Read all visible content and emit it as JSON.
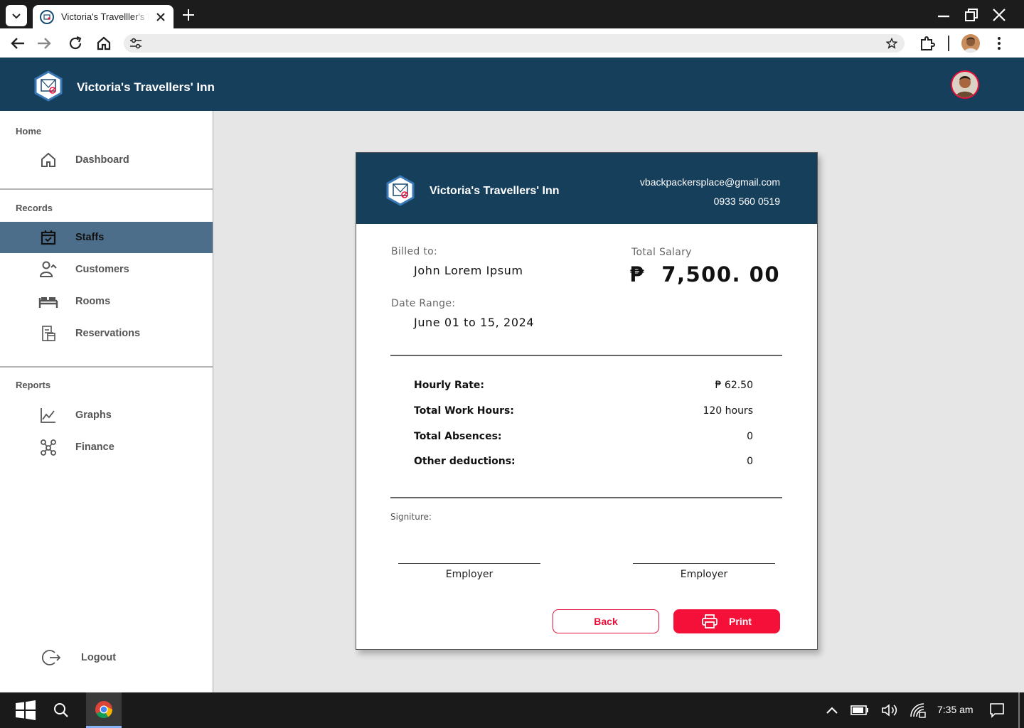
{
  "browser": {
    "tab_title": "Victoria's Travelller's Inn",
    "address": ""
  },
  "app": {
    "name": "Victoria's Travellers' Inn"
  },
  "sidebar": {
    "sections": [
      {
        "heading": "Home",
        "items": [
          {
            "label": "Dashboard",
            "icon": "home-icon"
          }
        ]
      },
      {
        "heading": "Records",
        "items": [
          {
            "label": "Staffs",
            "icon": "calendar-check-icon",
            "active": true
          },
          {
            "label": "Customers",
            "icon": "customers-icon"
          },
          {
            "label": "Rooms",
            "icon": "bed-icon"
          },
          {
            "label": "Reservations",
            "icon": "reservations-icon"
          }
        ]
      },
      {
        "heading": "Reports",
        "items": [
          {
            "label": "Graphs",
            "icon": "line-chart-icon"
          },
          {
            "label": "Finance",
            "icon": "finance-icon"
          }
        ]
      }
    ],
    "logout_label": "Logout"
  },
  "receipt": {
    "business_name": "Victoria's Travellers' Inn",
    "email": "vbackpackersplace@gmail.com",
    "phone": "0933 560 0519",
    "billed_to_label": "Billed to:",
    "billed_to": "John Lorem Ipsum",
    "date_range_label": "Date Range:",
    "date_range": "June 01 to 15, 2024",
    "total_label": "Total Salary",
    "total_amount": "₱  7,500. 00",
    "rows": [
      {
        "label": "Hourly Rate:",
        "value": "₱ 62.50"
      },
      {
        "label": "Total Work Hours:",
        "value": "120 hours"
      },
      {
        "label": "Total Absences:",
        "value": "0"
      },
      {
        "label": "Other deductions:",
        "value": "0"
      }
    ],
    "signature_label": "Signiture:",
    "signers": [
      "Employer",
      "Employer"
    ],
    "back_label": "Back",
    "print_label": "Print"
  },
  "taskbar": {
    "time": "7:35 am"
  },
  "colors": {
    "navy": "#163f5c",
    "active_item": "#4d6e8a",
    "accent_red": "#f5103a"
  }
}
